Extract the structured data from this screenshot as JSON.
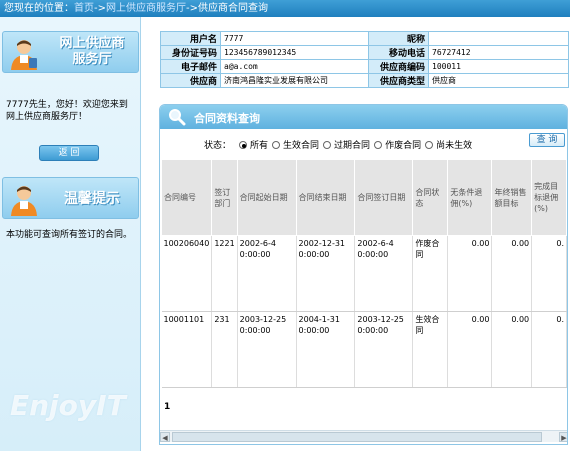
{
  "breadcrumb": {
    "prefix": "您现在的位置：",
    "home": "首页",
    "sep1": "->",
    "section": "网上供应商服务厅",
    "sep2": "->",
    "current": "供应商合同查询"
  },
  "sidebar": {
    "title_line1": "网上供应商",
    "title_line2": "服务厅",
    "welcome": "7777先生，您好！欢迎您来到网上供应商服务厅！",
    "back_label": "返 回",
    "tip_title": "温馨提示",
    "tip_text": "本功能可查询所有签订的合同。",
    "watermark": "EnjoyIT"
  },
  "user_info": {
    "username_label": "用户名",
    "username": "7777",
    "nickname_label": "昵称",
    "nickname": "",
    "idcard_label": "身份证号码",
    "idcard": "123456789012345",
    "mobile_label": "移动电话",
    "mobile": "76727412",
    "email_label": "电子邮件",
    "email": "a@a.com",
    "supplier_code_label": "供应商编码",
    "supplier_code": "100011",
    "supplier_label": "供应商",
    "supplier": "济南鸿昌隆实业发展有限公司",
    "supplier_type_label": "供应商类型",
    "supplier_type": "供应商"
  },
  "contract_query": {
    "title": "合同资料查询",
    "status_label": "状态：",
    "status_options": [
      "所有",
      "生效合同",
      "过期合同",
      "作废合同",
      "尚未生效"
    ],
    "selected_status": "所有",
    "query_label": "查 询",
    "columns": [
      "合同编号",
      "签订部门",
      "合同起始日期",
      "合同结束日期",
      "合同签订日期",
      "合同状态",
      "无条件退佣(%)",
      "年终销售额目标",
      "完成目标退佣(%)"
    ],
    "rows": [
      [
        "100206040",
        "1221",
        "2002-6-4 0:00:00",
        "2002-12-31 0:00:00",
        "2002-6-4 0:00:00",
        "作废合同",
        "0.00",
        "0.00",
        "0."
      ],
      [
        "10001101",
        "231",
        "2003-12-25 0:00:00",
        "2004-1-31 0:00:00",
        "2003-12-25 0:00:00",
        "生效合同",
        "0.00",
        "0.00",
        "0."
      ]
    ],
    "page": "1"
  },
  "colors": {
    "accent": "#1f7fbe",
    "panel_head": "#6fbbe4",
    "label_bg": "#d3ecf9"
  }
}
